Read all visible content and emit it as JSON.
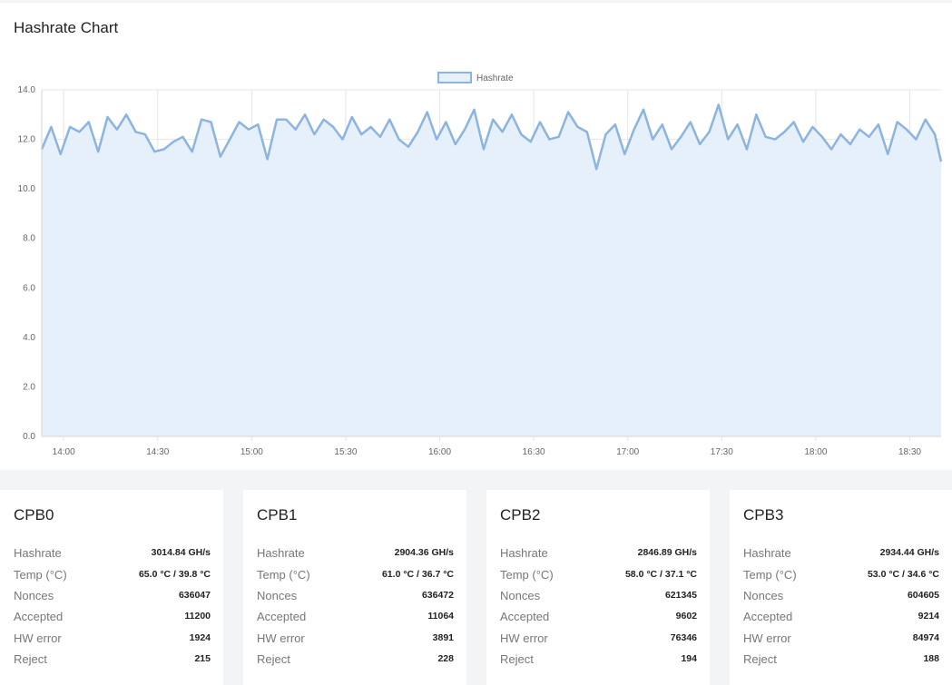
{
  "chart_panel": {
    "title": "Hashrate Chart"
  },
  "chart_data": {
    "type": "area",
    "legend": [
      "Hashrate"
    ],
    "legend_position": "top-center",
    "ylim": [
      0,
      14
    ],
    "y_ticks": [
      "0.0",
      "2.0",
      "4.0",
      "6.0",
      "8.0",
      "10.0",
      "12.0",
      "14.0"
    ],
    "x_ticks": [
      "14:00",
      "14:30",
      "15:00",
      "15:30",
      "16:00",
      "16:30",
      "17:00",
      "17:30",
      "18:00",
      "18:30"
    ],
    "x_range": [
      "13:53",
      "18:40"
    ],
    "grid": true,
    "colors": {
      "line": "#8cb4e0",
      "fill": "#e6f0fb"
    },
    "series": [
      {
        "name": "Hashrate",
        "x": [
          "13:53",
          "13:56",
          "13:59",
          "14:02",
          "14:05",
          "14:08",
          "14:11",
          "14:14",
          "14:17",
          "14:20",
          "14:23",
          "14:26",
          "14:29",
          "14:32",
          "14:35",
          "14:38",
          "14:41",
          "14:44",
          "14:47",
          "14:50",
          "14:53",
          "14:56",
          "14:59",
          "15:02",
          "15:05",
          "15:08",
          "15:11",
          "15:14",
          "15:17",
          "15:20",
          "15:23",
          "15:26",
          "15:29",
          "15:32",
          "15:35",
          "15:38",
          "15:41",
          "15:44",
          "15:47",
          "15:50",
          "15:53",
          "15:56",
          "15:59",
          "16:02",
          "16:05",
          "16:08",
          "16:11",
          "16:14",
          "16:17",
          "16:20",
          "16:23",
          "16:26",
          "16:29",
          "16:32",
          "16:35",
          "16:38",
          "16:41",
          "16:44",
          "16:47",
          "16:50",
          "16:53",
          "16:56",
          "16:59",
          "17:02",
          "17:05",
          "17:08",
          "17:11",
          "17:14",
          "17:17",
          "17:20",
          "17:23",
          "17:26",
          "17:29",
          "17:32",
          "17:35",
          "17:38",
          "17:41",
          "17:44",
          "17:47",
          "17:50",
          "17:53",
          "17:56",
          "17:59",
          "18:02",
          "18:05",
          "18:08",
          "18:11",
          "18:14",
          "18:17",
          "18:20",
          "18:23",
          "18:26",
          "18:29",
          "18:32",
          "18:35",
          "18:38",
          "18:40"
        ],
        "values": [
          11.6,
          12.5,
          11.4,
          12.5,
          12.3,
          12.7,
          11.5,
          12.9,
          12.4,
          13.0,
          12.3,
          12.2,
          11.5,
          11.6,
          11.9,
          12.1,
          11.5,
          12.8,
          12.7,
          11.3,
          12.0,
          12.7,
          12.4,
          12.6,
          11.2,
          12.8,
          12.8,
          12.4,
          13.0,
          12.2,
          12.8,
          12.5,
          12.0,
          12.9,
          12.2,
          12.5,
          12.1,
          12.8,
          12.0,
          11.7,
          12.3,
          13.1,
          12.0,
          12.7,
          11.8,
          12.4,
          13.2,
          11.6,
          12.8,
          12.3,
          13.0,
          12.2,
          11.9,
          12.7,
          12.0,
          12.1,
          13.1,
          12.5,
          12.3,
          10.8,
          12.2,
          12.6,
          11.4,
          12.4,
          13.2,
          12.0,
          12.6,
          11.6,
          12.1,
          12.7,
          11.8,
          12.3,
          13.4,
          12.0,
          12.6,
          11.6,
          13.0,
          12.1,
          12.0,
          12.3,
          12.7,
          11.9,
          12.5,
          12.1,
          11.6,
          12.2,
          11.8,
          12.4,
          12.1,
          12.6,
          11.4,
          12.7,
          12.4,
          12.0,
          12.8,
          12.2,
          11.1
        ]
      }
    ]
  },
  "cards": [
    {
      "title": "CPB0",
      "stats": [
        {
          "label": "Hashrate",
          "value": "3014.84 GH/s"
        },
        {
          "label": "Temp (°C)",
          "value": "65.0 °C / 39.8 °C"
        },
        {
          "label": "Nonces",
          "value": "636047"
        },
        {
          "label": "Accepted",
          "value": "11200"
        },
        {
          "label": "HW error",
          "value": "1924"
        },
        {
          "label": "Reject",
          "value": "215"
        }
      ]
    },
    {
      "title": "CPB1",
      "stats": [
        {
          "label": "Hashrate",
          "value": "2904.36 GH/s"
        },
        {
          "label": "Temp (°C)",
          "value": "61.0 °C / 36.7 °C"
        },
        {
          "label": "Nonces",
          "value": "636472"
        },
        {
          "label": "Accepted",
          "value": "11064"
        },
        {
          "label": "HW error",
          "value": "3891"
        },
        {
          "label": "Reject",
          "value": "228"
        }
      ]
    },
    {
      "title": "CPB2",
      "stats": [
        {
          "label": "Hashrate",
          "value": "2846.89 GH/s"
        },
        {
          "label": "Temp (°C)",
          "value": "58.0 °C / 37.1 °C"
        },
        {
          "label": "Nonces",
          "value": "621345"
        },
        {
          "label": "Accepted",
          "value": "9602"
        },
        {
          "label": "HW error",
          "value": "76346"
        },
        {
          "label": "Reject",
          "value": "194"
        }
      ]
    },
    {
      "title": "CPB3",
      "stats": [
        {
          "label": "Hashrate",
          "value": "2934.44 GH/s"
        },
        {
          "label": "Temp (°C)",
          "value": "53.0 °C / 34.6 °C"
        },
        {
          "label": "Nonces",
          "value": "604605"
        },
        {
          "label": "Accepted",
          "value": "9214"
        },
        {
          "label": "HW error",
          "value": "84974"
        },
        {
          "label": "Reject",
          "value": "188"
        }
      ]
    }
  ]
}
